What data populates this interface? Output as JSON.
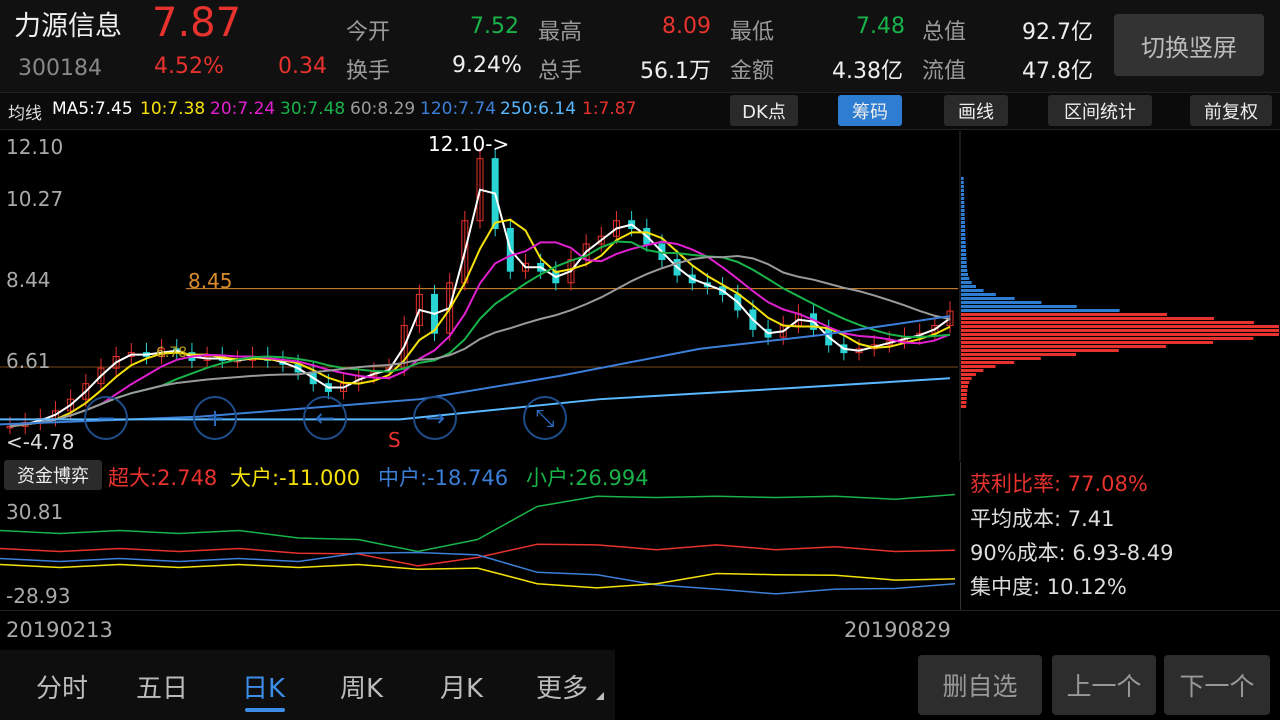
{
  "stock": {
    "name": "力源信息",
    "price": "7.87",
    "code": "300184",
    "change_pct": "4.52%",
    "change": "0.34"
  },
  "quote": {
    "open_label": "今开",
    "open": "7.52",
    "high_label": "最高",
    "high": "8.09",
    "low_label": "最低",
    "low": "7.48",
    "cap_label": "总值",
    "cap": "92.7亿",
    "turnover_label": "换手",
    "turnover": "9.24%",
    "volume_label": "总手",
    "volume": "56.1万",
    "amount_label": "金额",
    "amount": "4.38亿",
    "float_label": "流值",
    "float": "47.8亿"
  },
  "switch_button": "切换竖屏",
  "ma": {
    "label": "均线",
    "ma5": "MA5:7.45",
    "ma10": "10:7.38",
    "ma20": "20:7.24",
    "ma30": "30:7.48",
    "ma60": "60:8.29",
    "ma120": "120:7.74",
    "ma250": "250:6.14",
    "ma1": "1:7.87"
  },
  "toolbar": {
    "dk": "DK点",
    "chips": "筹码",
    "draw": "画线",
    "range": "区间统计",
    "adjust": "前复权"
  },
  "price_axis": [
    "12.10",
    "10.27",
    "8.44",
    "6.61"
  ],
  "annotations": {
    "high_mark": "12.10->",
    "level": "8.45",
    "low_mark": "<-4.78",
    "signal": "S",
    "ma_tag": "6.78"
  },
  "fund_flow": {
    "button": "资金博弈",
    "super_large": "超大:2.748",
    "large": "大户:-11.000",
    "medium": "中户:-18.746",
    "small": "小户:26.994",
    "axis_top": "30.81",
    "axis_bottom": "-28.93"
  },
  "chip_stats": {
    "profit_ratio": "获利比率: 77.08%",
    "avg_cost": "平均成本: 7.41",
    "cost90": "90%成本: 6.93-8.49",
    "concentration": "集中度: 10.12%"
  },
  "dates": {
    "start": "20190213",
    "end": "20190829"
  },
  "tabs": [
    "分时",
    "五日",
    "日K",
    "周K",
    "月K",
    "更多"
  ],
  "active_tab": "日K",
  "bottom_buttons": {
    "remove": "删自选",
    "prev": "上一个",
    "next": "下一个"
  },
  "colors": {
    "up": "#e8322d",
    "down": "#19b34a",
    "accent": "#2d7dd2",
    "ma5": "#ffffff",
    "ma10": "#f5e10a",
    "ma20": "#e020d0",
    "ma30": "#19b34a",
    "ma60": "#9a9a9a",
    "ma120": "#3b7fd9",
    "ma250": "#59b8ff"
  },
  "chart_data": {
    "type": "candlestick",
    "x_range": [
      "20190213",
      "20190829"
    ],
    "y_axis_ticks": [
      12.1,
      10.27,
      8.44,
      6.61
    ],
    "close_series": [
      4.9,
      5.0,
      5.1,
      5.3,
      5.6,
      6.0,
      6.4,
      6.7,
      6.8,
      6.7,
      6.9,
      6.8,
      6.6,
      6.7,
      6.6,
      6.6,
      6.7,
      6.6,
      6.5,
      6.3,
      6.0,
      5.8,
      6.0,
      6.2,
      6.3,
      6.4,
      7.5,
      8.3,
      7.3,
      8.6,
      10.2,
      11.8,
      10.0,
      8.9,
      9.1,
      8.9,
      8.6,
      9.2,
      9.6,
      9.8,
      10.2,
      10.0,
      9.6,
      9.2,
      8.8,
      8.6,
      8.5,
      8.3,
      7.9,
      7.4,
      7.2,
      7.5,
      7.8,
      7.4,
      7.0,
      6.8,
      6.9,
      7.0,
      7.1,
      7.2,
      7.3,
      7.5,
      7.87
    ],
    "volume_profile_peak_price": 7.41
  }
}
